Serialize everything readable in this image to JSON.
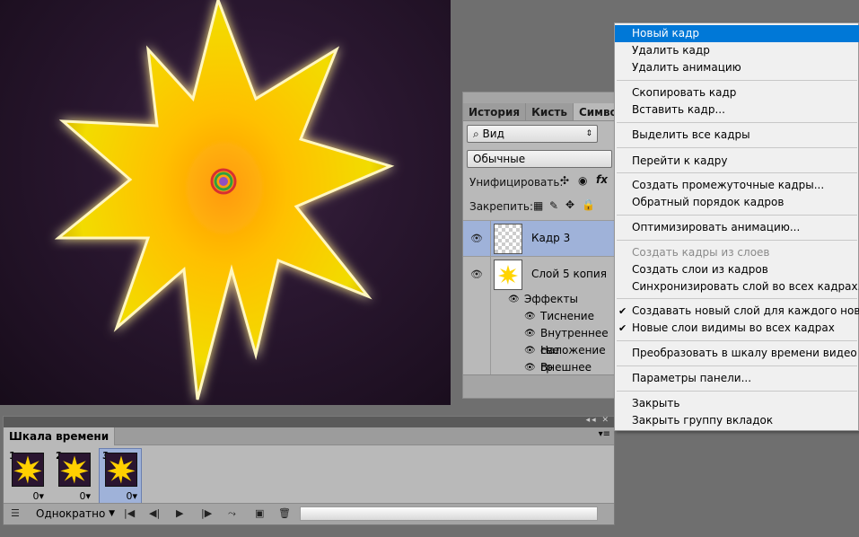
{
  "layers_panel": {
    "tabs": [
      "История",
      "Кисть",
      "Символ"
    ],
    "filter_value": "Вид",
    "blend_mode": "Обычные",
    "unify_label": "Унифицировать:",
    "lock_label": "Закрепить:",
    "layers": [
      {
        "name": "Кадр 3",
        "selected": true
      },
      {
        "name": "Слой 5 копия",
        "selected": false
      }
    ],
    "effects_label": "Эффекты",
    "effects": [
      "Тиснение",
      "Внутреннее све",
      "Наложение гр",
      "Внешнее свеч"
    ]
  },
  "timeline": {
    "tab": "Шкала времени",
    "frames": [
      {
        "num": "1",
        "delay": "0"
      },
      {
        "num": "2",
        "delay": "0"
      },
      {
        "num": "3",
        "delay": "0",
        "selected": true
      }
    ],
    "loop": "Однократно"
  },
  "context_menu": {
    "items": [
      {
        "label": "Новый кадр",
        "highlighted": true
      },
      {
        "label": "Удалить кадр"
      },
      {
        "label": "Удалить анимацию"
      },
      {
        "label": "Скопировать кадр"
      },
      {
        "label": "Вставить кадр..."
      },
      {
        "label": "Выделить все кадры"
      },
      {
        "label": "Перейти к кадру"
      },
      {
        "label": "Создать промежуточные кадры..."
      },
      {
        "label": "Обратный порядок кадров"
      },
      {
        "label": "Оптимизировать анимацию..."
      },
      {
        "label": "Создать кадры из слоев",
        "disabled": true
      },
      {
        "label": "Создать слои из кадров"
      },
      {
        "label": "Синхронизировать слой во всех кадрах..."
      },
      {
        "label": "Создавать новый слой для каждого нового кадра",
        "checked": true
      },
      {
        "label": "Новые слои видимы во всех кадрах",
        "checked": true
      },
      {
        "label": "Преобразовать в шкалу времени видео"
      },
      {
        "label": "Параметры панели..."
      },
      {
        "label": "Закрыть"
      },
      {
        "label": "Закрыть группу вкладок"
      }
    ]
  },
  "colors": {
    "menu_highlight": "#0078d7",
    "selection": "#9fb2d9",
    "star_fill": "#ffd400",
    "canvas_bg": "#2a1730"
  }
}
